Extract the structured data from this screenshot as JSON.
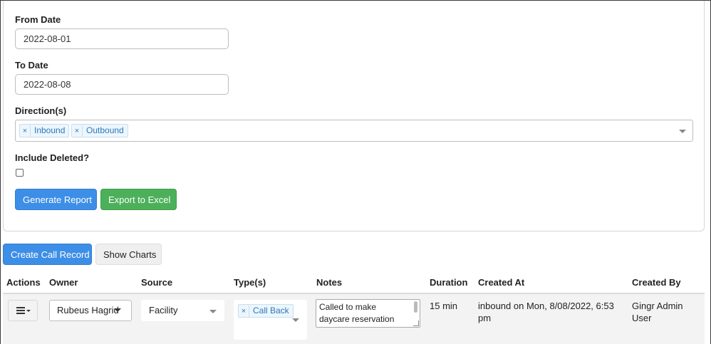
{
  "filters": {
    "from_date": {
      "label": "From Date",
      "value": "2022-08-01"
    },
    "to_date": {
      "label": "To Date",
      "value": "2022-08-08"
    },
    "directions": {
      "label": "Direction(s)",
      "tags": [
        "Inbound",
        "Outbound"
      ],
      "remove_glyph": "×"
    },
    "include_deleted": {
      "label": "Include Deleted?",
      "checked": false
    },
    "generate_button": "Generate Report",
    "export_button": "Export to Excel"
  },
  "toolbar": {
    "create_button": "Create Call Record",
    "charts_button": "Show Charts"
  },
  "table": {
    "headers": [
      "Actions",
      "Owner",
      "Source",
      "Type(s)",
      "Notes",
      "Duration",
      "Created At",
      "Created By"
    ],
    "rows": [
      {
        "actions_icon": "hamburger-menu-icon",
        "owner": "Rubeus Hagrid",
        "source": "Facility",
        "types": [
          "Call Back"
        ],
        "notes": "Called to make daycare reservation",
        "duration": "15 min",
        "created_at": "inbound on Mon, 8/08/2022, 6:53 pm",
        "created_by": "Gingr Admin User"
      }
    ]
  },
  "colors": {
    "primary": "#3d8ee6",
    "success": "#4cb05a",
    "tag_text": "#2b78b8"
  }
}
